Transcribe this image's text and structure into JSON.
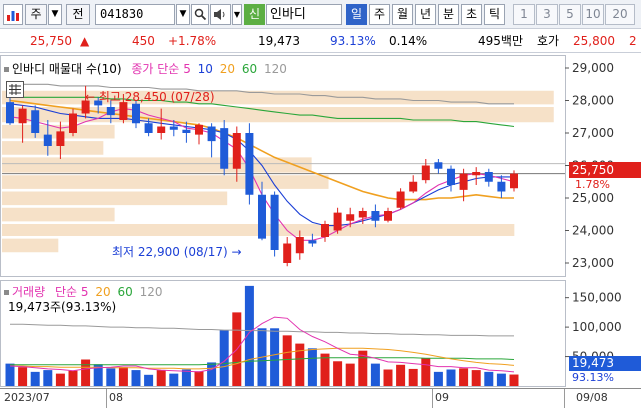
{
  "toolbar": {
    "market_label": "주",
    "jeon_label": "전",
    "stock_code": "041830",
    "sin_badge": "신",
    "stock_name": "인바디",
    "periods": [
      "일",
      "주",
      "월",
      "년",
      "분",
      "초",
      "틱"
    ],
    "active_period": "일",
    "minutes": [
      "1",
      "3",
      "5",
      "10",
      "20"
    ],
    "icons": [
      "chart-icon",
      "dropdown-icon",
      "search-icon",
      "speaker-icon"
    ]
  },
  "price_bar": {
    "price": "25,750",
    "change_arrow": "▲",
    "change": "450",
    "change_pct": "+1.78%",
    "volume": "19,473",
    "vol_ratio": "93.13%",
    "turnover": "0.14%",
    "amount": "495백만",
    "bid_label": "호가",
    "bid_price": "25,800",
    "trailing": "2"
  },
  "price_chart": {
    "legend_title": "인바디 매물대 수(10)",
    "legend_ma_label": "종가 단순",
    "legend_ma_periods": [
      "5",
      "10",
      "20",
      "60",
      "120"
    ],
    "high_label": "최고 28,450 (07/28)",
    "low_label": "최저 22,900 (08/17)",
    "current_price_tag": "25,750",
    "current_pct_tag": "1.78%",
    "y_ticks": [
      "29,000",
      "28,000",
      "27,000",
      "26,000",
      "25,000",
      "24,000",
      "23,000"
    ]
  },
  "volume_chart": {
    "legend_title": "거래량",
    "legend_ma_label": "단순",
    "legend_ma_periods": [
      "5",
      "20",
      "60",
      "120"
    ],
    "volume_summary": "19,473주(93.13%)",
    "y_ticks": [
      "150,000",
      "100,000",
      "50,000"
    ],
    "current_volume_tag": "19,473",
    "current_pct_tag": "93.13%"
  },
  "date_axis": {
    "labels": [
      "2023/07",
      "08",
      "09",
      "09/08"
    ]
  },
  "colors": {
    "up": "#e0201b",
    "down": "#1f5bd8",
    "ma5": "#e234b0",
    "ma10": "#1b3fd6",
    "ma20": "#f0a020",
    "ma60": "#2aa63a",
    "ma120": "#9a9a9a",
    "profile": "#f6e1c8"
  },
  "chart_data": {
    "type": "candlestick",
    "x_range": [
      "2023/07",
      "09/08"
    ],
    "y_range": [
      22600,
      29400
    ],
    "volume_range": [
      0,
      180000
    ],
    "candles": [
      {
        "o": 27950,
        "h": 28300,
        "l": 27250,
        "c": 27300,
        "v": 38000
      },
      {
        "o": 27300,
        "h": 27850,
        "l": 26700,
        "c": 27750,
        "v": 32000
      },
      {
        "o": 27700,
        "h": 27850,
        "l": 26850,
        "c": 27000,
        "v": 24000
      },
      {
        "o": 26950,
        "h": 27400,
        "l": 26300,
        "c": 26600,
        "v": 27000
      },
      {
        "o": 26600,
        "h": 27350,
        "l": 26200,
        "c": 27050,
        "v": 21000
      },
      {
        "o": 27000,
        "h": 27750,
        "l": 26900,
        "c": 27600,
        "v": 26000
      },
      {
        "o": 27600,
        "h": 28450,
        "l": 27450,
        "c": 28000,
        "v": 45000
      },
      {
        "o": 28000,
        "h": 28100,
        "l": 27600,
        "c": 27850,
        "v": 37000
      },
      {
        "o": 27800,
        "h": 28000,
        "l": 27300,
        "c": 27550,
        "v": 30000
      },
      {
        "o": 27400,
        "h": 28200,
        "l": 27300,
        "c": 27950,
        "v": 32000
      },
      {
        "o": 27900,
        "h": 28000,
        "l": 27150,
        "c": 27300,
        "v": 27000
      },
      {
        "o": 27300,
        "h": 27450,
        "l": 26900,
        "c": 27000,
        "v": 19000
      },
      {
        "o": 27000,
        "h": 27750,
        "l": 26800,
        "c": 27200,
        "v": 27000
      },
      {
        "o": 27200,
        "h": 27400,
        "l": 26900,
        "c": 27100,
        "v": 21000
      },
      {
        "o": 27100,
        "h": 27350,
        "l": 26700,
        "c": 27000,
        "v": 28000
      },
      {
        "o": 26950,
        "h": 27300,
        "l": 26650,
        "c": 27250,
        "v": 25000
      },
      {
        "o": 27200,
        "h": 27300,
        "l": 26250,
        "c": 26750,
        "v": 40000
      },
      {
        "o": 27150,
        "h": 27400,
        "l": 25700,
        "c": 25900,
        "v": 95000
      },
      {
        "o": 25900,
        "h": 27200,
        "l": 25500,
        "c": 27000,
        "v": 125000
      },
      {
        "o": 27000,
        "h": 27300,
        "l": 24800,
        "c": 25100,
        "v": 170000
      },
      {
        "o": 25100,
        "h": 25500,
        "l": 23700,
        "c": 23750,
        "v": 98000
      },
      {
        "o": 25100,
        "h": 25200,
        "l": 23200,
        "c": 23400,
        "v": 98000
      },
      {
        "o": 23000,
        "h": 23800,
        "l": 22900,
        "c": 23600,
        "v": 86000
      },
      {
        "o": 23300,
        "h": 24000,
        "l": 23100,
        "c": 23800,
        "v": 72000
      },
      {
        "o": 23700,
        "h": 23900,
        "l": 23500,
        "c": 23600,
        "v": 64000
      },
      {
        "o": 23800,
        "h": 24300,
        "l": 23650,
        "c": 24200,
        "v": 55000
      },
      {
        "o": 24000,
        "h": 24700,
        "l": 23900,
        "c": 24550,
        "v": 42000
      },
      {
        "o": 24300,
        "h": 24700,
        "l": 24100,
        "c": 24500,
        "v": 38000
      },
      {
        "o": 24400,
        "h": 24700,
        "l": 24200,
        "c": 24600,
        "v": 60000
      },
      {
        "o": 24600,
        "h": 24800,
        "l": 24100,
        "c": 24300,
        "v": 38000
      },
      {
        "o": 24300,
        "h": 24700,
        "l": 24250,
        "c": 24600,
        "v": 28000
      },
      {
        "o": 24700,
        "h": 25300,
        "l": 24650,
        "c": 25200,
        "v": 36000
      },
      {
        "o": 25200,
        "h": 25700,
        "l": 25150,
        "c": 25500,
        "v": 29000
      },
      {
        "o": 25550,
        "h": 26200,
        "l": 25450,
        "c": 26000,
        "v": 47000
      },
      {
        "o": 26100,
        "h": 26200,
        "l": 25750,
        "c": 25900,
        "v": 24000
      },
      {
        "o": 25900,
        "h": 26000,
        "l": 25200,
        "c": 25400,
        "v": 28000
      },
      {
        "o": 25250,
        "h": 25900,
        "l": 24900,
        "c": 25750,
        "v": 30000
      },
      {
        "o": 25700,
        "h": 25950,
        "l": 25400,
        "c": 25800,
        "v": 27000
      },
      {
        "o": 25800,
        "h": 25900,
        "l": 25350,
        "c": 25500,
        "v": 24000
      },
      {
        "o": 25500,
        "h": 25700,
        "l": 25000,
        "c": 25200,
        "v": 21000
      },
      {
        "o": 25300,
        "h": 25850,
        "l": 25200,
        "c": 25750,
        "v": 19473
      }
    ],
    "ma5": [
      27500,
      27450,
      27350,
      27250,
      27150,
      27200,
      27350,
      27450,
      27650,
      27750,
      27700,
      27550,
      27450,
      27350,
      27150,
      27100,
      27000,
      26750,
      26500,
      25900,
      25100,
      24500,
      24000,
      23700,
      23700,
      23800,
      24000,
      24200,
      24350,
      24450,
      24500,
      24650,
      24850,
      25150,
      25400,
      25550,
      25700,
      25750,
      25700,
      25600,
      25500
    ],
    "ma10": [
      27900,
      27850,
      27800,
      27700,
      27600,
      27550,
      27500,
      27450,
      27450,
      27450,
      27400,
      27350,
      27300,
      27250,
      27200,
      27150,
      27100,
      27000,
      26800,
      26450,
      26000,
      25400,
      24900,
      24500,
      24250,
      24150,
      24150,
      24200,
      24300,
      24400,
      24500,
      24650,
      24850,
      25050,
      25250,
      25400,
      25500,
      25600,
      25650,
      25650,
      25650
    ],
    "ma20": [
      28000,
      27950,
      27900,
      27850,
      27800,
      27750,
      27700,
      27650,
      27600,
      27550,
      27500,
      27450,
      27400,
      27350,
      27300,
      27250,
      27150,
      27000,
      26850,
      26650,
      26450,
      26250,
      26100,
      25950,
      25800,
      25650,
      25500,
      25350,
      25200,
      25100,
      25000,
      24950,
      24950,
      24950,
      25000,
      25000,
      25050,
      25100,
      25050,
      25000,
      25000
    ],
    "ma60": [
      28100,
      28100,
      28100,
      28100,
      28100,
      28100,
      28100,
      28100,
      28050,
      28050,
      28000,
      28000,
      28000,
      27950,
      27950,
      27900,
      27900,
      27850,
      27800,
      27750,
      27700,
      27650,
      27600,
      27550,
      27550,
      27500,
      27450,
      27450,
      27450,
      27450,
      27450,
      27450,
      27400,
      27400,
      27400,
      27400,
      27350,
      27350,
      27300,
      27250,
      27200
    ],
    "ma120": [
      28500,
      28500,
      28500,
      28500,
      28450,
      28450,
      28450,
      28450,
      28400,
      28400,
      28400,
      28400,
      28350,
      28350,
      28350,
      28300,
      28300,
      28300,
      28300,
      28250,
      28250,
      28200,
      28200,
      28200,
      28150,
      28150,
      28100,
      28100,
      28100,
      28050,
      28050,
      28050,
      28000,
      28000,
      28000,
      27950,
      27950,
      27950,
      27900,
      27900,
      27900
    ],
    "vol_ma5": [
      34000,
      33000,
      31000,
      29000,
      28000,
      26000,
      29000,
      31000,
      32000,
      34000,
      34000,
      29000,
      27000,
      26000,
      25000,
      24000,
      28000,
      42000,
      62000,
      91000,
      106000,
      117000,
      115000,
      96000,
      84000,
      75000,
      64000,
      54000,
      52000,
      47000,
      41000,
      40000,
      38000,
      36000,
      33000,
      33000,
      31000,
      31000,
      27000,
      26000,
      24000
    ],
    "vol_ma20": [
      34000,
      34000,
      33000,
      33000,
      32000,
      32000,
      32000,
      32000,
      31000,
      31000,
      31000,
      30000,
      30000,
      30000,
      29000,
      29000,
      30000,
      33000,
      38000,
      45000,
      49000,
      53000,
      57000,
      60000,
      62000,
      63000,
      64000,
      64000,
      64000,
      63000,
      62000,
      60000,
      57000,
      54000,
      50000,
      46000,
      43000,
      40000,
      38000,
      37000,
      35000
    ],
    "vol_ma60": [
      36000,
      36000,
      36000,
      36000,
      36000,
      36000,
      36000,
      36000,
      36000,
      36000,
      36000,
      36000,
      36000,
      36000,
      36000,
      36000,
      37000,
      38000,
      40000,
      42000,
      43000,
      44000,
      45000,
      46000,
      47000,
      48000,
      48000,
      48000,
      48000,
      48000,
      48000,
      48000,
      48000,
      47000,
      47000,
      47000,
      47000,
      46000,
      46000,
      46000,
      45000
    ],
    "vol_ma120": [
      105000,
      105000,
      104000,
      103000,
      103000,
      102000,
      102000,
      101000,
      100000,
      100000,
      99000,
      99000,
      98000,
      98000,
      97000,
      96000,
      96000,
      95000,
      95000,
      94000,
      94000,
      93000,
      93000,
      92000,
      92000,
      91000,
      91000,
      90000,
      90000,
      89000,
      89000,
      88000,
      88000,
      87000,
      87000,
      86000,
      86000,
      86000,
      85000,
      85000,
      85000
    ],
    "volume_profile": [
      {
        "price_low": 27850,
        "price_high": 28300,
        "width": 0.98
      },
      {
        "price_low": 27300,
        "price_high": 27800,
        "width": 0.98
      },
      {
        "price_low": 26800,
        "price_high": 27250,
        "width": 0.2
      },
      {
        "price_low": 26300,
        "price_high": 26750,
        "width": 0.18
      },
      {
        "price_low": 25750,
        "price_high": 26250,
        "width": 0.55
      },
      {
        "price_low": 25250,
        "price_high": 25700,
        "width": 0.58
      },
      {
        "price_low": 24750,
        "price_high": 25200,
        "width": 0.4
      },
      {
        "price_low": 24250,
        "price_high": 24700,
        "width": 0.2
      },
      {
        "price_low": 23800,
        "price_high": 24200,
        "width": 0.91
      },
      {
        "price_low": 23300,
        "price_high": 23750,
        "width": 0.1
      }
    ]
  }
}
